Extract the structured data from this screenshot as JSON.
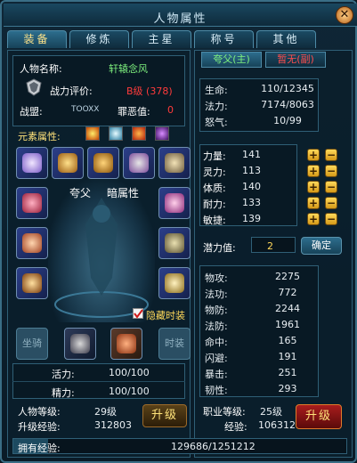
{
  "window": {
    "title": "人物属性",
    "close_label": "✕"
  },
  "tabs": [
    {
      "label": "装备",
      "active": true
    },
    {
      "label": "修炼",
      "active": false
    },
    {
      "label": "主星",
      "active": false
    },
    {
      "label": "称号",
      "active": false
    },
    {
      "label": "其他",
      "active": false
    }
  ],
  "character": {
    "name_label": "人物名称:",
    "name": "轩辕念风",
    "rating_label": "战力评价:",
    "rating": "B级 (378)",
    "guild_label": "战盟:",
    "guild": "TOOXX",
    "evil_label": "罪恶值:",
    "evil": "0",
    "element_label": "元素属性:",
    "school": "夸父",
    "hidden_attr": "暗属性",
    "hide_fashion_label": "隐藏时装",
    "hide_fashion_checked": true,
    "mount_label": "坐骑",
    "fashion_label": "时装",
    "vigor_label": "活力:",
    "vigor": "100/100",
    "energy_label": "精力:",
    "energy": "100/100",
    "level_label": "人物等级:",
    "level": "29级",
    "upgrade_exp_label": "升级经验:",
    "upgrade_exp": "312803",
    "upgrade_button": "升级",
    "exp_label": "拥有经验:",
    "exp": "129686/1251212"
  },
  "sub_tabs": [
    {
      "label": "夸父(主)",
      "active": true
    },
    {
      "label": "暂无(副)",
      "active": false
    }
  ],
  "vitals": [
    {
      "label": "生命:",
      "value": "110/12345"
    },
    {
      "label": "法力:",
      "value": "7174/8063"
    },
    {
      "label": "怒气:",
      "value": "10/99"
    }
  ],
  "attributes": [
    {
      "label": "力量:",
      "value": "141"
    },
    {
      "label": "灵力:",
      "value": "113"
    },
    {
      "label": "体质:",
      "value": "140"
    },
    {
      "label": "耐力:",
      "value": "133"
    },
    {
      "label": "敏捷:",
      "value": "139"
    }
  ],
  "potential_label": "潜力值:",
  "potential": "2",
  "confirm_button": "确定",
  "combat": [
    {
      "label": "物攻:",
      "value": "2275"
    },
    {
      "label": "法功:",
      "value": "772"
    },
    {
      "label": "物防:",
      "value": "2244"
    },
    {
      "label": "法防:",
      "value": "1961"
    },
    {
      "label": "命中:",
      "value": "165"
    },
    {
      "label": "闪避:",
      "value": "191"
    },
    {
      "label": "暴击:",
      "value": "251"
    },
    {
      "label": "韧性:",
      "value": "293"
    }
  ],
  "class_level_label": "职业等级:",
  "class_level": "25级",
  "class_exp_label": "经验:",
  "class_exp": "106312",
  "class_upgrade_button": "升级",
  "icons": {
    "element_icons": [
      "fire-element-icon",
      "ice-element-icon",
      "flame-element-icon",
      "dark-element-icon"
    ],
    "equipment": [
      "wing-icon",
      "gauntlet-icon",
      "shoulder-icon",
      "necklace-icon",
      "ring-icon",
      "bracer-icon",
      "belt-icon",
      "armor-icon",
      "cape-icon",
      "boots-icon",
      "orb-icon",
      "armlet-icon",
      "chest-armor-icon",
      "weapon-icon"
    ]
  },
  "colors": {
    "accent_gold": "#ffd95a",
    "rating_red": "#ff3b3b",
    "name_green": "#7ef07e",
    "tab_active": "#ffe48a"
  }
}
